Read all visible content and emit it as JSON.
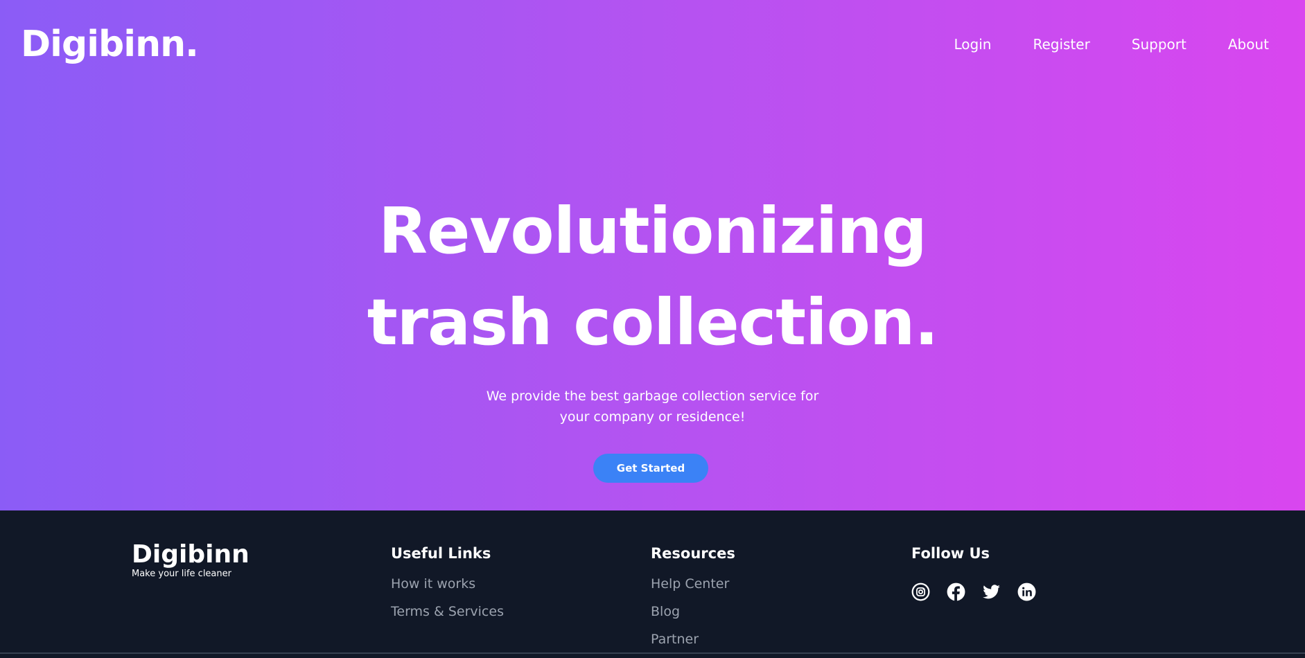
{
  "header": {
    "logo": "Digibinn.",
    "nav": [
      "Login",
      "Register",
      "Support",
      "About"
    ]
  },
  "hero": {
    "title_line1": "Revolutionizing",
    "title_line2": "trash collection.",
    "subtitle_line1": "We provide the best garbage collection service for",
    "subtitle_line2": "your company or residence!",
    "cta": "Get Started"
  },
  "footer": {
    "brand": "Digibinn",
    "tagline": "Make your life cleaner",
    "useful": {
      "heading": "Useful Links",
      "links": [
        "How it works",
        "Terms & Services"
      ]
    },
    "resources": {
      "heading": "Resources",
      "links": [
        "Help Center",
        "Blog",
        "Partner"
      ]
    },
    "follow": {
      "heading": "Follow Us",
      "icons": [
        "instagram-icon",
        "facebook-icon",
        "twitter-icon",
        "linkedin-icon"
      ]
    }
  },
  "colors": {
    "gradient_start": "#8b5cf6",
    "gradient_end": "#d946ef",
    "button": "#3b82f6",
    "footer_bg": "#111827"
  }
}
